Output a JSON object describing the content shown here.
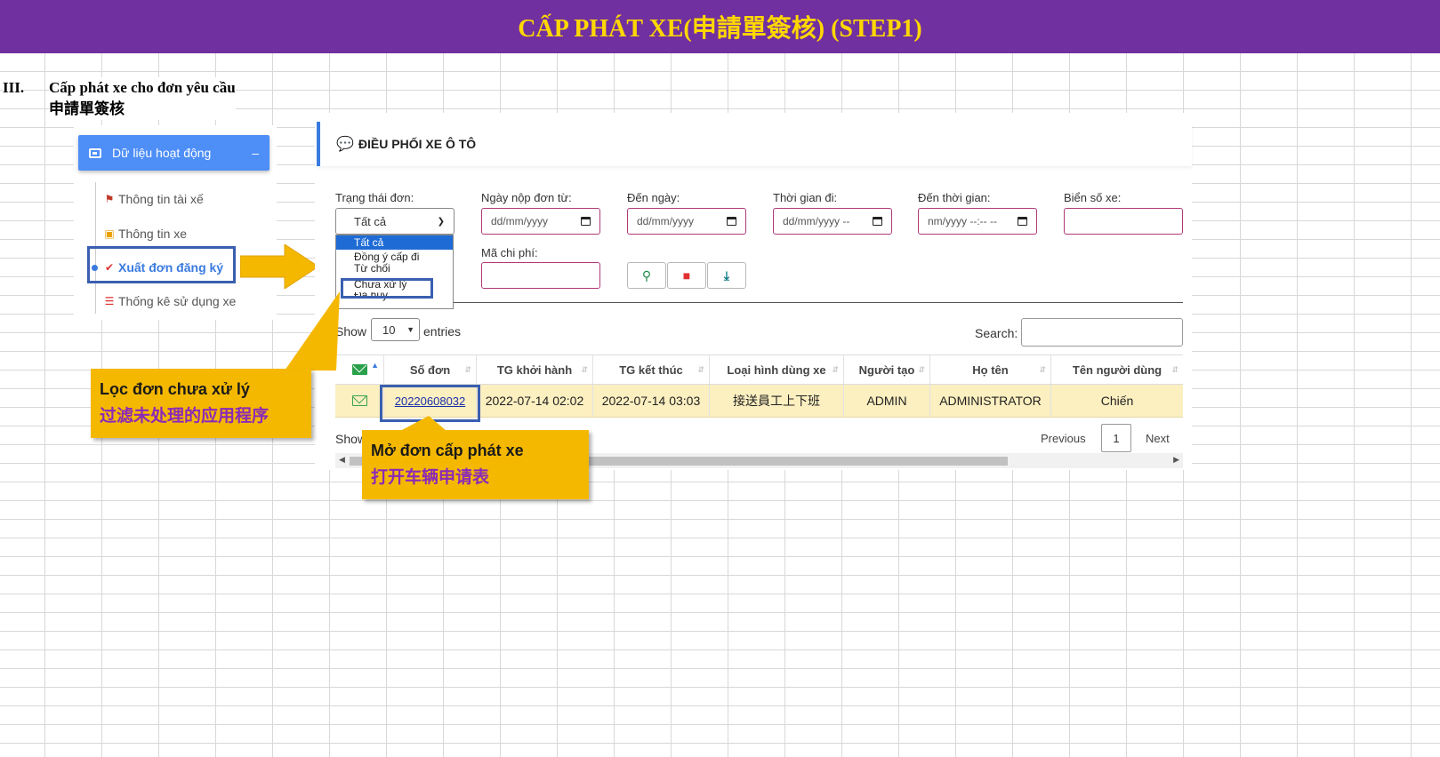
{
  "banner": {
    "title": "CẤP PHÁT XE(申請單簽核) (STEP1)"
  },
  "section": {
    "number": "III.",
    "title_vi": "Cấp phát xe cho đơn yêu cầu",
    "title_zh": "申請單簽核"
  },
  "sidebar": {
    "header": "Dữ liệu hoạt động",
    "collapse": "–",
    "items": [
      {
        "label": "Thông tin tài xế",
        "icon": "driver-icon"
      },
      {
        "label": "Thông tin xe",
        "icon": "bus-icon"
      },
      {
        "label": "Xuất đơn đăng ký",
        "icon": "check-icon",
        "active": true
      },
      {
        "label": "Thống kê sử dụng xe",
        "icon": "list-icon"
      }
    ]
  },
  "panel": {
    "title": "ĐIỀU PHỐI XE Ô TÔ",
    "icon": "chat-dollar-icon"
  },
  "filters": {
    "status_label": "Trạng thái đơn:",
    "status_value": "Tất cả",
    "status_options": [
      "Tất cả",
      "Đồng ý cấp đi",
      "Từ chối",
      "Chưa xử lý",
      "Đã hủy"
    ],
    "date_from_label": "Ngày nộp đơn từ:",
    "date_from_placeholder": "dd/mm/yyyy",
    "date_to_label": "Đến ngày:",
    "date_to_placeholder": "dd/mm/yyyy",
    "time_from_label": "Thời gian đi:",
    "time_from_placeholder": "dd/mm/yyyy --",
    "time_to_label": "Đến thời gian:",
    "time_to_placeholder": "nm/yyyy --:-- --",
    "plate_label": "Biển số xe:",
    "cost_label": "Mã chi phí:"
  },
  "actions": {
    "search": "search-icon",
    "delete": "trash-icon",
    "export": "download-icon"
  },
  "table": {
    "show": "Show",
    "entries_value": "10",
    "entries": "entries",
    "search_label": "Search:",
    "columns": [
      "",
      "Số đơn",
      "TG khởi hành",
      "TG kết thúc",
      "Loại hình dùng xe",
      "Người tạo",
      "Họ tên",
      "Tên người dùng"
    ],
    "rows": [
      [
        "",
        "20220608032",
        "2022-07-14 02:02",
        "2022-07-14 03:03",
        "接送員工上下班",
        "ADMIN",
        "ADMINISTRATOR",
        "Chiến"
      ]
    ],
    "info": "Show",
    "previous": "Previous",
    "page": "1",
    "next": "Next"
  },
  "callouts": {
    "filter_vi": "Lọc đơn chưa xử lý",
    "filter_zh": "过滤未处理的应用程序",
    "open_vi": "Mở đơn cấp phát xe",
    "open_zh": "打开车辆申请表"
  },
  "colors": {
    "banner": "#7030a0",
    "banner_text": "#ffd700",
    "accent": "#4d8ef7",
    "callout": "#f5b800",
    "row_highlight": "#fcefc0"
  }
}
